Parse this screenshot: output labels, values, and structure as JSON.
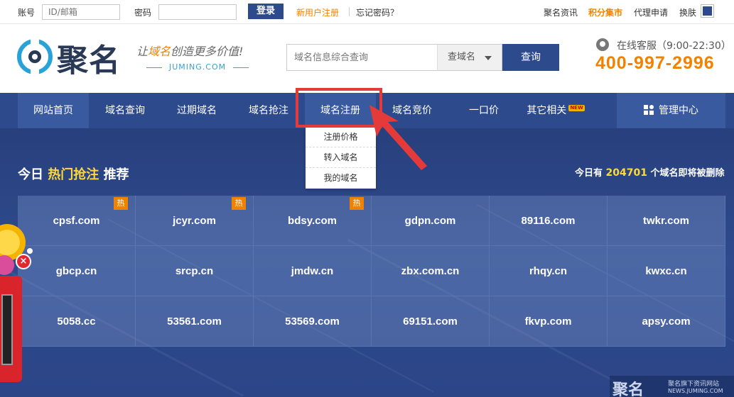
{
  "topbar": {
    "account_label": "账号",
    "account_placeholder": "ID/邮箱",
    "password_label": "密码",
    "login_button": "登录",
    "register_link": "新用户注册",
    "forgot_link": "忘记密码？",
    "news_link": "聚名资讯",
    "points_link": "积分集市",
    "agent_link": "代理申请",
    "skin_link": "换肤"
  },
  "header": {
    "logo_text": "聚名",
    "slogan_prefix": "让",
    "slogan_highlight": "域名",
    "slogan_suffix": "创造更多价值!",
    "logo_domain": "JUMING.COM",
    "search_placeholder": "域名信息综合查询",
    "search_type": "查域名",
    "search_button": "查询",
    "service_label": "在线客服（9:00-22:30）",
    "hotline": "400-997-2996"
  },
  "nav": {
    "items": [
      {
        "label": "网站首页"
      },
      {
        "label": "域名查询"
      },
      {
        "label": "过期域名"
      },
      {
        "label": "域名抢注"
      },
      {
        "label": "域名注册"
      },
      {
        "label": "域名竞价"
      },
      {
        "label": "一口价"
      },
      {
        "label": "其它相关"
      }
    ],
    "new_badge": "NEW",
    "management": "管理中心"
  },
  "dropdown": {
    "items": [
      {
        "label": "注册价格"
      },
      {
        "label": "转入域名"
      },
      {
        "label": "我的域名"
      }
    ]
  },
  "hot": {
    "title_prefix": "今日",
    "title_highlight": "热门抢注",
    "title_suffix": "推荐",
    "delete_prefix": "今日有",
    "delete_count": "204701",
    "delete_suffix": "个域名即将被删除",
    "hot_badge": "热",
    "domains": [
      "cpsf.com",
      "jcyr.com",
      "bdsy.com",
      "gdpn.com",
      "89116.com",
      "twkr.com",
      "gbcp.cn",
      "srcp.cn",
      "jmdw.cn",
      "zbx.com.cn",
      "rhqy.cn",
      "kwxc.cn",
      "5058.cc",
      "53561.com",
      "53569.com",
      "69151.com",
      "fkvp.com",
      "apsy.com"
    ]
  },
  "ad": {
    "close_label": "×"
  },
  "watermark": {
    "logo": "聚名",
    "caption": "聚名旗下资讯网站",
    "url": "NEWS.JUMING.COM"
  },
  "colors": {
    "brand_blue": "#2c4a8c",
    "accent_orange": "#f08200",
    "highlight_red": "#e43a3a"
  }
}
